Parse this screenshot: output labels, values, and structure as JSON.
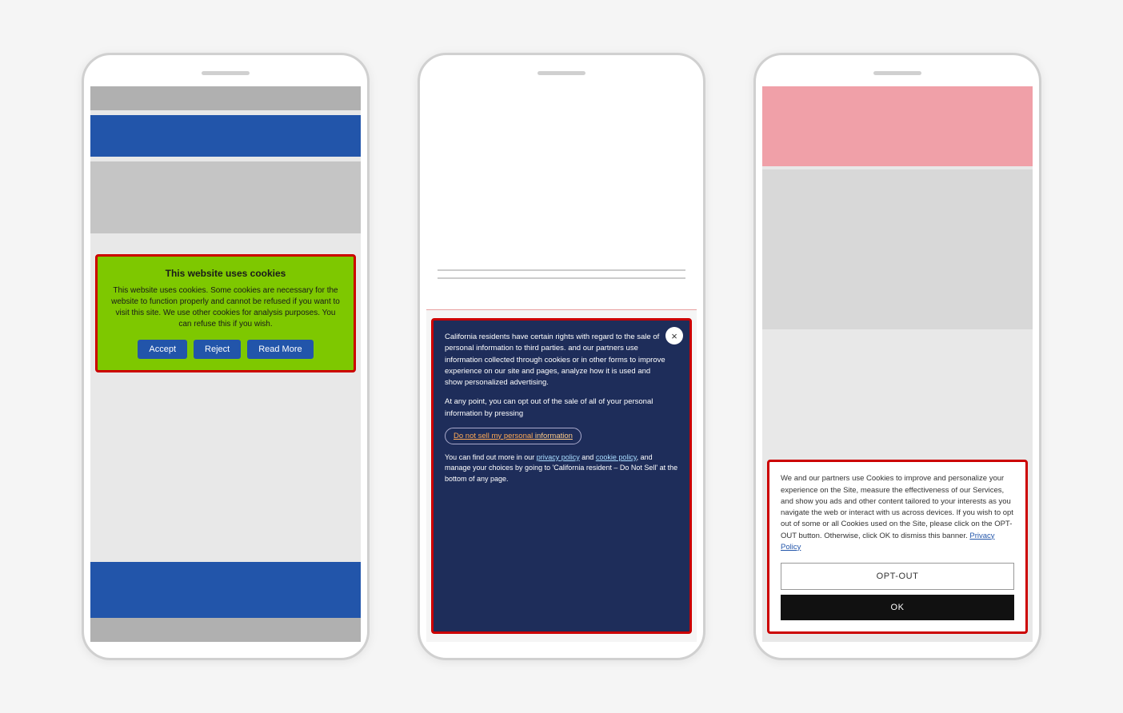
{
  "page": {
    "background": "#f5f5f5"
  },
  "phone1": {
    "banner": {
      "title": "This website uses cookies",
      "text": "This website uses cookies. Some cookies are necessary for the website to function properly and cannot be refused if you want to visit this site. We use other cookies for analysis purposes. You can refuse this if you wish.",
      "accept_label": "Accept",
      "reject_label": "Reject",
      "read_more_label": "Read More"
    }
  },
  "phone2": {
    "banner": {
      "close_label": "×",
      "paragraph1": "California residents have certain rights with regard to the sale of personal information to third parties.",
      "paragraph1b": "and our partners use information collected through cookies or in other forms to improve experience on our site and pages, analyze how it is used and show personalized advertising.",
      "paragraph2": "At any point, you can opt out of the sale of all of your personal information by pressing",
      "do_not_sell_label": "Do not sell my personal information",
      "do_not_sell_highlight": "information",
      "paragraph3": "You can find out more in our privacy policy and cookie policy, and manage your choices by going to 'California resident – Do Not Sell' at the bottom of any page.",
      "privacy_policy_label": "privacy policy",
      "cookie_policy_label": "cookie policy"
    }
  },
  "phone3": {
    "banner": {
      "text": "We and our partners use Cookies to improve and personalize your experience on the Site, measure the effectiveness of our Services, and show you ads and other content tailored to your interests as you navigate the web or interact with us across devices. If you wish to opt out of some or all Cookies used on the Site, please click on the OPT-OUT button. Otherwise, click OK to dismiss this banner.",
      "privacy_policy_label": "Privacy Policy",
      "opt_out_label": "OPT-OUT",
      "ok_label": "OK"
    }
  }
}
